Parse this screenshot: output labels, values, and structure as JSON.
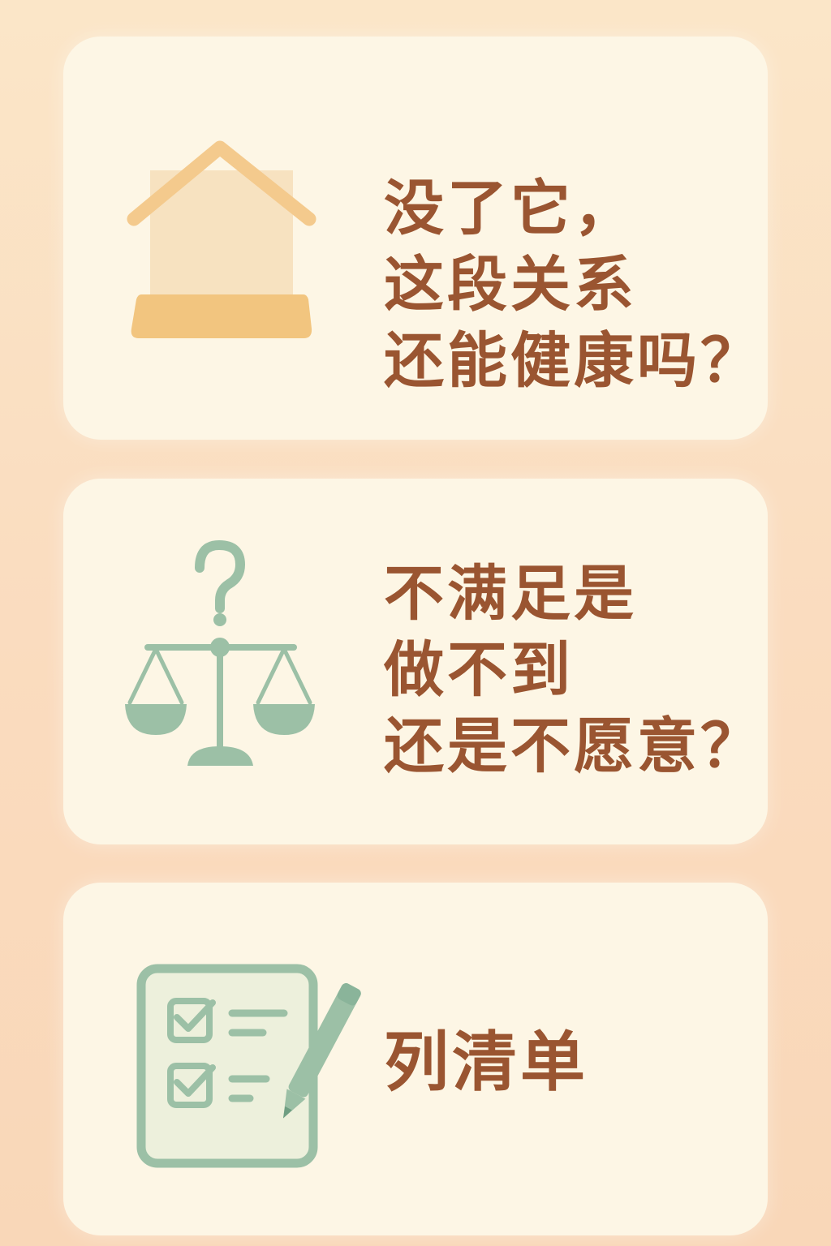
{
  "cards": [
    {
      "icon": "house-icon",
      "lines": [
        "没了它，",
        "这段关系",
        "还能健康吗？"
      ]
    },
    {
      "icon": "scale-question-icon",
      "lines": [
        "不满足是",
        "做不到",
        "还是不愿意？"
      ]
    },
    {
      "icon": "checklist-pen-icon",
      "lines": [
        "列清单"
      ]
    }
  ],
  "colors": {
    "text": "#9a5531",
    "card": "#fdf6e5",
    "house": "#f1c787",
    "green": "#9cc0a6"
  }
}
